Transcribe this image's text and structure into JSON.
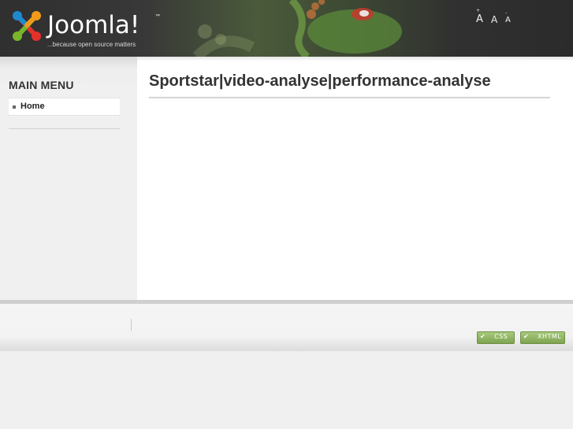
{
  "header": {
    "logo_text": "Joomla!",
    "logo_tm": "™",
    "tagline": "...because open source matters",
    "font_size": {
      "large": "A",
      "large_sup": "+",
      "normal": "A",
      "small": "A",
      "small_sup": "-"
    }
  },
  "sidebar": {
    "menu_title": "MAIN MENU",
    "items": [
      {
        "label": "Home"
      }
    ]
  },
  "main": {
    "title": "Sportstar|video-analyse|performance-analyse"
  },
  "footer": {
    "badges": {
      "css": "CSS",
      "xhtml": "XHTML"
    }
  },
  "colors": {
    "header_bg": "#2f2f2f",
    "badge_green": "#8fb760",
    "content_bg": "#ffffff",
    "page_bg": "#f0f0f0"
  }
}
